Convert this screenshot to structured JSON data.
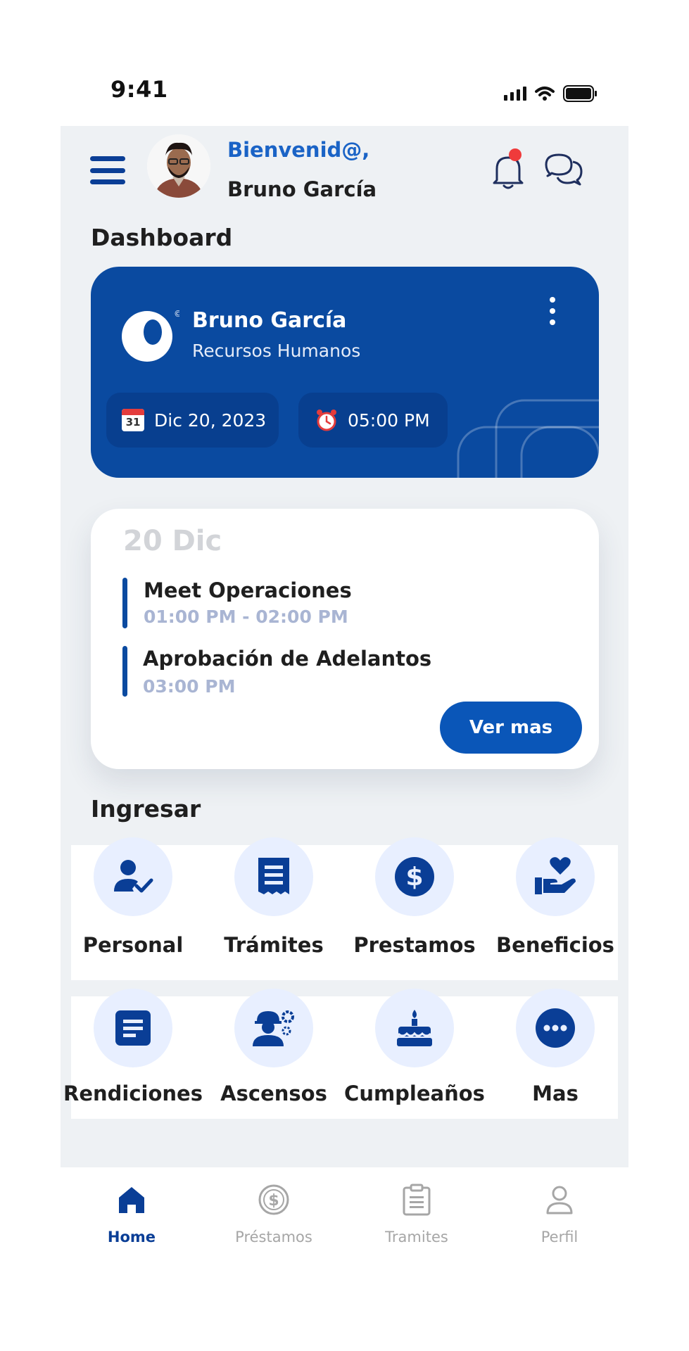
{
  "status_bar": {
    "time": "9:41"
  },
  "header": {
    "welcome": "Bienvenid@,",
    "user_name": "Bruno García"
  },
  "dashboard": {
    "title": "Dashboard",
    "card": {
      "name": "Bruno García",
      "department": "Recursos Humanos",
      "date": "Dic 20, 2023",
      "time": "05:00 PM",
      "calendar_day": "31"
    }
  },
  "agenda": {
    "date": "20 Dic",
    "events": [
      {
        "title": "Meet Operaciones",
        "time": "01:00 PM - 02:00 PM"
      },
      {
        "title": "Aprobación de Adelantos",
        "time": "03:00 PM"
      }
    ],
    "more_label": "Ver mas"
  },
  "ingresar": {
    "title": "Ingresar",
    "items": [
      {
        "label": "Personal",
        "icon": "user-check-icon"
      },
      {
        "label": "Trámites",
        "icon": "receipt-icon"
      },
      {
        "label": "Prestamos",
        "icon": "dollar-coin-icon"
      },
      {
        "label": "Beneficios",
        "icon": "hand-heart-icon"
      },
      {
        "label": "Rendiciones",
        "icon": "document-icon"
      },
      {
        "label": "Ascensos",
        "icon": "worker-gear-icon"
      },
      {
        "label": "Cumpleaños",
        "icon": "cake-icon"
      },
      {
        "label": "Mas",
        "icon": "more-dots-icon"
      }
    ]
  },
  "bottom_nav": {
    "items": [
      {
        "label": "Home",
        "icon": "home-icon",
        "active": true
      },
      {
        "label": "Préstamos",
        "icon": "dollar-circle-icon",
        "active": false
      },
      {
        "label": "Tramites",
        "icon": "clipboard-icon",
        "active": false
      },
      {
        "label": "Perfil",
        "icon": "user-icon",
        "active": false
      }
    ]
  },
  "colors": {
    "primary": "#0a4aa0",
    "accent_text": "#1a63c6",
    "app_background": "#eef1f4",
    "icon_circle": "#e8efff",
    "notification_dot": "#ef3b3b",
    "inactive_nav": "#a6a6a6"
  }
}
